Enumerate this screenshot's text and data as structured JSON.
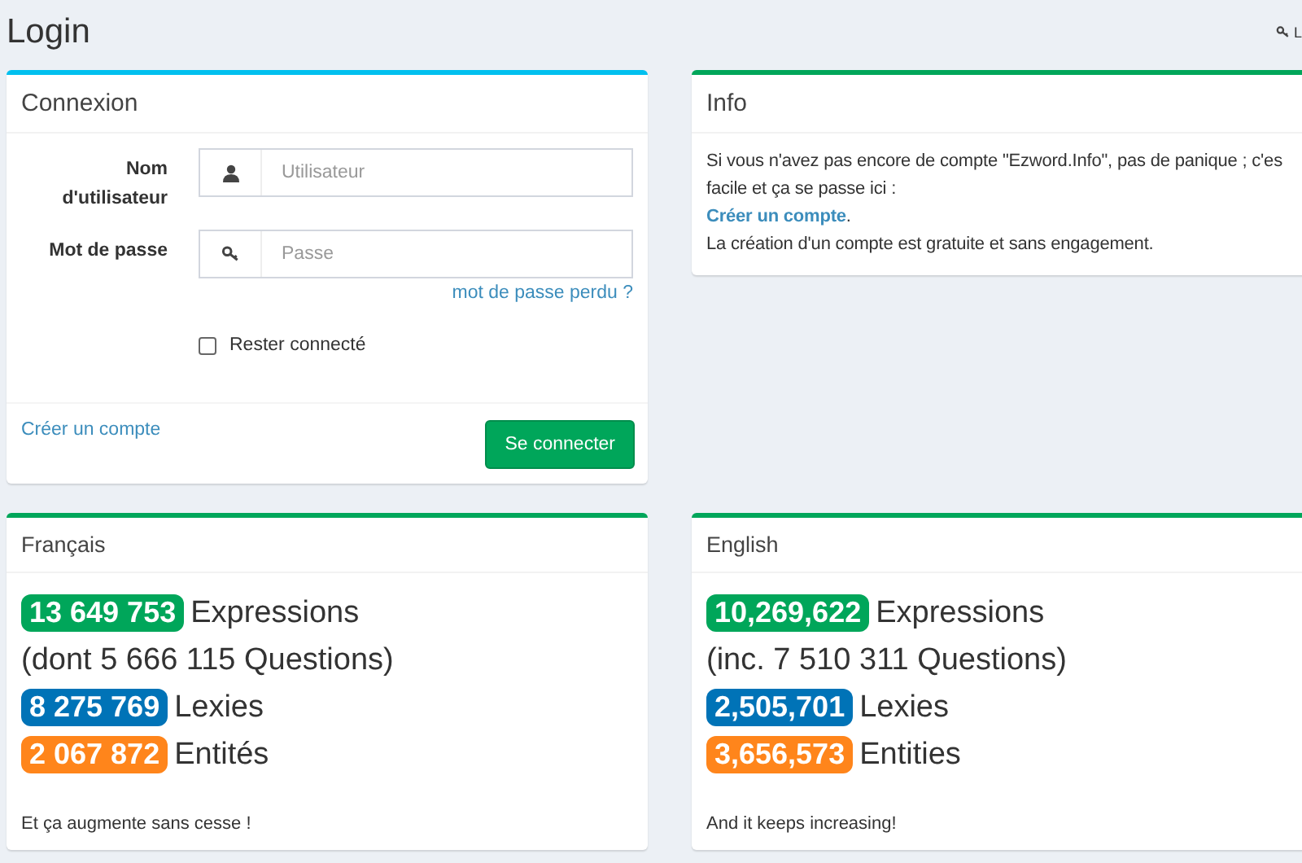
{
  "page": {
    "title": "Login",
    "top_link": "L"
  },
  "login_card": {
    "title": "Connexion",
    "fields": [
      {
        "kind": "user",
        "label": "Nom d'utilisateur",
        "placeholder": "Utilisateur"
      },
      {
        "kind": "password",
        "label": "Mot de passe",
        "placeholder": "Passe"
      }
    ],
    "lost_password": "mot de passe perdu ?",
    "remember": {
      "label": "Rester connecté",
      "checked": false
    },
    "create_link": "Créer un compte",
    "submit": "Se connecter"
  },
  "info_card": {
    "title": "Info",
    "line_1": "Si vous n'avez pas encore de compte \"Ezword.Info\", pas de panique ; c'es",
    "line_2": "facile et ça se passe ici :",
    "link": "Créer un compte",
    "link_after": ".",
    "line_3": "La création d'un compte est gratuite et sans engagement."
  },
  "stats_cards": [
    {
      "title": "Français",
      "rows": [
        {
          "kind": "badge",
          "count": "13 649 753",
          "label": "Expressions",
          "color": "#00a65a"
        },
        {
          "kind": "note",
          "text": "(dont 5 666 115 Questions)"
        },
        {
          "kind": "badge",
          "count": "8 275 769",
          "label": "Lexies",
          "color": "#0073b7"
        },
        {
          "kind": "badge",
          "count": "2 067 872",
          "label": "Entités",
          "color": "#ff851b"
        }
      ],
      "footer": "Et ça augmente sans cesse !"
    },
    {
      "title": "English",
      "rows": [
        {
          "kind": "badge",
          "count": "10,269,622",
          "label": "Expressions",
          "color": "#00a65a"
        },
        {
          "kind": "note",
          "text": "(inc. 7 510 311 Questions)"
        },
        {
          "kind": "badge",
          "count": "2,505,701",
          "label": "Lexies",
          "color": "#0073b7"
        },
        {
          "kind": "badge",
          "count": "3,656,573",
          "label": "Entities",
          "color": "#ff851b"
        }
      ],
      "footer": "And it keeps increasing!"
    }
  ]
}
